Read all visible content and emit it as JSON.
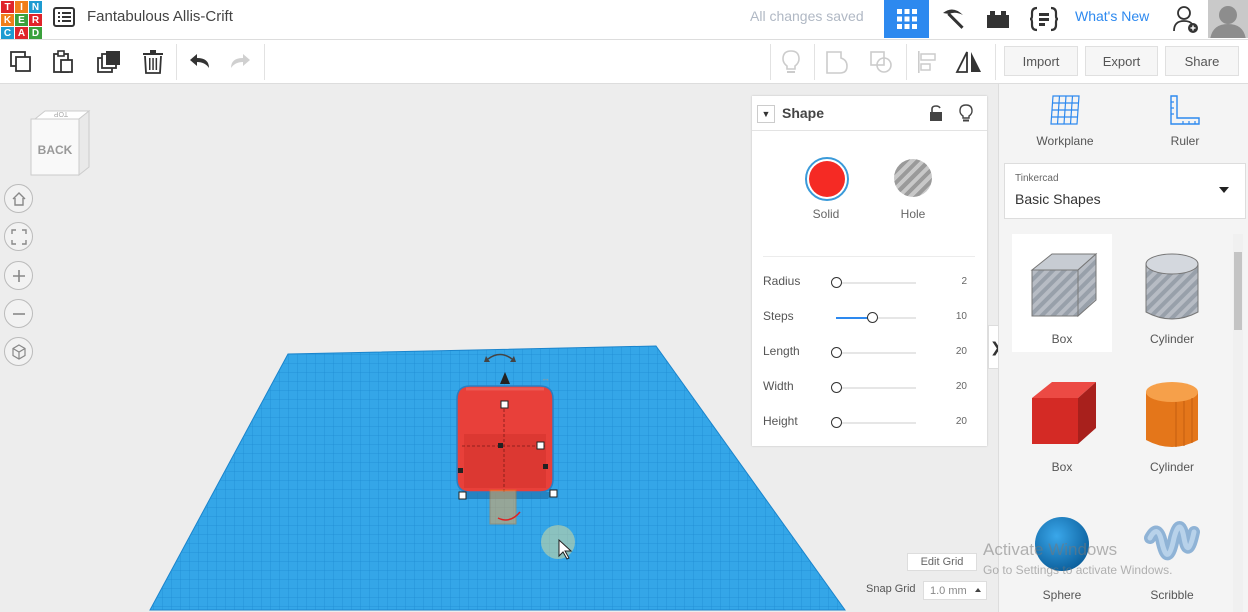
{
  "app": {
    "name": "Tinkercad",
    "logo_letters": [
      "T",
      "I",
      "N",
      "K",
      "E",
      "R",
      "C",
      "A",
      "D"
    ],
    "accent_color": "#2d89ef"
  },
  "header": {
    "design_title": "Fantabulous Allis-Crift",
    "save_status": "All changes saved",
    "whats_new": "What's New",
    "icons": [
      "menu-icon",
      "3d-design-view-icon",
      "pickaxe-icon",
      "bricks-icon",
      "codeblocks-icon",
      "add-user-icon",
      "avatar"
    ]
  },
  "toolbar": {
    "left_tools": [
      "copy-icon",
      "paste-icon",
      "duplicate-icon",
      "delete-icon",
      "undo-icon",
      "redo-icon"
    ],
    "right_tools": [
      "lightbulb-icon",
      "group-icon",
      "hole-shape-icon",
      "align-icon",
      "mirror-icon"
    ],
    "import_label": "Import",
    "export_label": "Export",
    "share_label": "Share"
  },
  "viewcube": {
    "face_label": "BACK"
  },
  "inspector": {
    "title": "Shape",
    "solid_label": "Solid",
    "hole_label": "Hole",
    "solid_color": "#f52a24",
    "params": [
      {
        "label": "Radius",
        "value": "2",
        "fraction": 0.0
      },
      {
        "label": "Steps",
        "value": "10",
        "fraction": 0.45
      },
      {
        "label": "Length",
        "value": "20",
        "fraction": 0.0
      },
      {
        "label": "Width",
        "value": "20",
        "fraction": 0.0
      },
      {
        "label": "Height",
        "value": "20",
        "fraction": 0.0
      }
    ]
  },
  "right_panel": {
    "workplane_label": "Workplane",
    "ruler_label": "Ruler",
    "library_category": "Tinkercad",
    "library_name": "Basic Shapes",
    "shapes": [
      {
        "label": "Box",
        "kind": "box-hole"
      },
      {
        "label": "Cylinder",
        "kind": "cylinder-hole"
      },
      {
        "label": "Box",
        "kind": "box"
      },
      {
        "label": "Cylinder",
        "kind": "cylinder"
      },
      {
        "label": "Sphere",
        "kind": "sphere"
      },
      {
        "label": "Scribble",
        "kind": "scribble"
      }
    ]
  },
  "grid": {
    "edit_grid_label": "Edit Grid",
    "snap_grid_label": "Snap Grid",
    "snap_value": "1.0 mm"
  },
  "watermark": {
    "line1": "Activate Windows",
    "line2": "Go to Settings to activate Windows."
  }
}
